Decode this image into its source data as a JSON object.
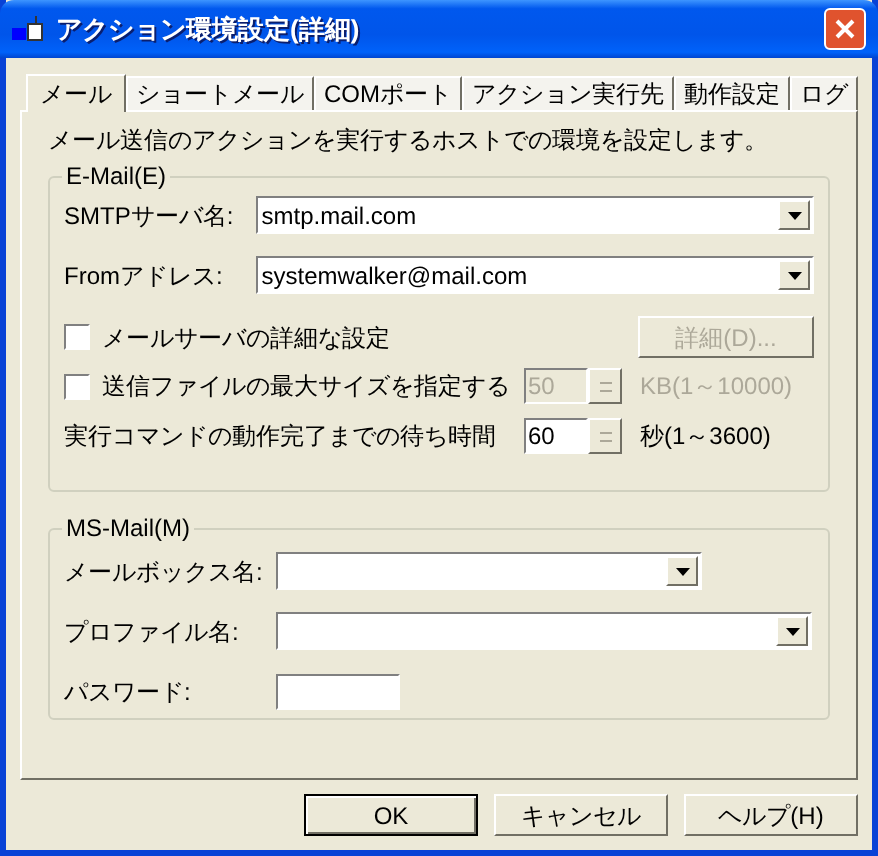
{
  "window": {
    "title": "アクション環境設定(詳細)"
  },
  "tabs": [
    {
      "label": "メール",
      "selected": true
    },
    {
      "label": "ショートメール",
      "selected": false
    },
    {
      "label": "COMポート",
      "selected": false
    },
    {
      "label": "アクション実行先",
      "selected": false
    },
    {
      "label": "動作設定",
      "selected": false
    },
    {
      "label": "ログ",
      "selected": false
    }
  ],
  "description": "メール送信のアクションを実行するホストでの環境を設定します。",
  "email_group": {
    "title": "E-Mail(E)",
    "fields": [
      {
        "label": "SMTPサーバ名:",
        "value": "smtp.mail.com"
      },
      {
        "label": "Fromアドレス:",
        "value": "systemwalker@mail.com"
      }
    ],
    "server_detail": {
      "label": "メールサーバの詳細な設定",
      "checked": false,
      "button": "詳細(D)...",
      "button_disabled": true
    },
    "max_size": {
      "label": "送信ファイルの最大サイズを指定する",
      "checked": false,
      "value": "50",
      "unit": "KB(1～10000)",
      "disabled": true
    },
    "wait": {
      "label": "実行コマンドの動作完了までの待ち時間",
      "value": "60",
      "unit": "秒(1～3600)",
      "disabled": false
    }
  },
  "msmail_group": {
    "title": "MS-Mail(M)",
    "fields": [
      {
        "kind": "combo_short",
        "label": "メールボックス名:"
      },
      {
        "kind": "combo",
        "label": "プロファイル名:"
      },
      {
        "kind": "text",
        "label": "パスワード:"
      }
    ]
  },
  "buttons": [
    {
      "label": "OK",
      "default": true
    },
    {
      "label": "キャンセル",
      "default": false
    },
    {
      "label": "ヘルプ(H)",
      "default": false
    }
  ]
}
